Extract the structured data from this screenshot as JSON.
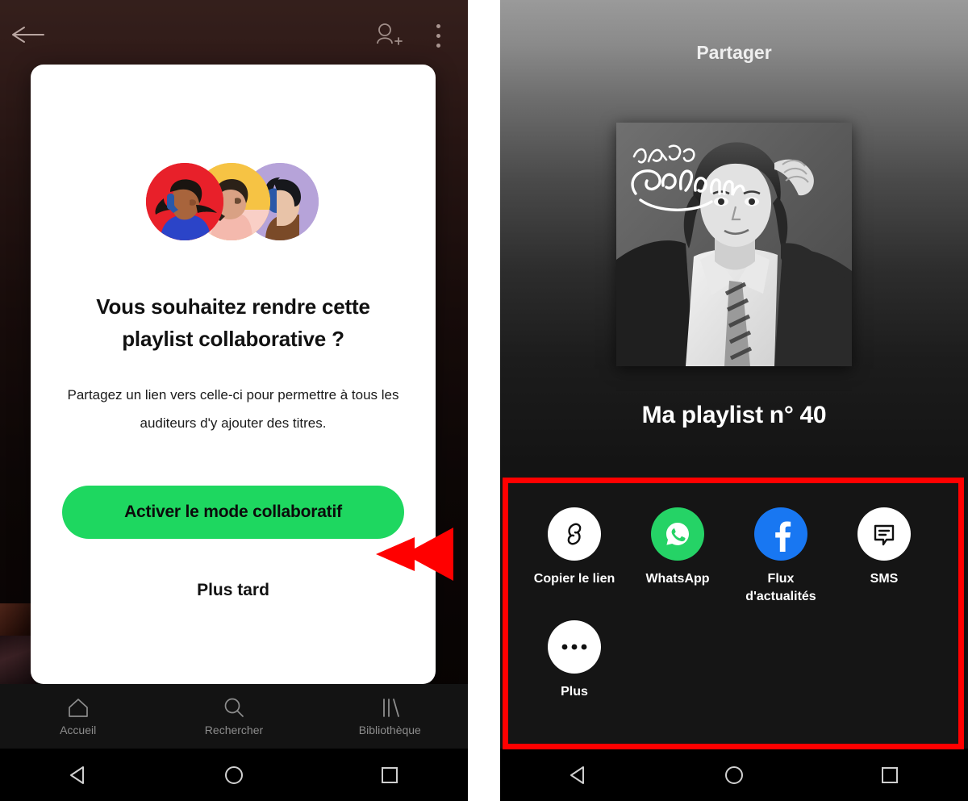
{
  "left_screen": {
    "topbar": {
      "back_icon": "arrow-left-icon",
      "add_person_icon": "person-add-icon",
      "overflow_icon": "kebab-menu-icon"
    },
    "modal": {
      "illustration": "three-listeners-avatars-illustration",
      "title": "Vous souhaitez rendre cette playlist collaborative ?",
      "body": "Partagez un lien vers celle-ci pour permettre à tous les auditeurs d'y ajouter des titres.",
      "primary_button": "Activer le mode collaboratif",
      "secondary_button": "Plus tard"
    },
    "annotation": {
      "arrow_color": "#ff0000",
      "points_to": "Activer le mode collaboratif"
    },
    "bottom_nav": [
      {
        "label": "Accueil",
        "icon": "home-icon"
      },
      {
        "label": "Rechercher",
        "icon": "search-icon"
      },
      {
        "label": "Bibliothèque",
        "icon": "library-icon"
      }
    ],
    "system_nav": [
      {
        "icon": "triangle-back-icon"
      },
      {
        "icon": "circle-home-icon"
      },
      {
        "icon": "square-recents-icon"
      }
    ]
  },
  "right_screen": {
    "header_title": "Partager",
    "album_art": {
      "artist_script": "Jean-Jacques",
      "artist_script_line2": "Goldman",
      "description": "black-and-white-portrait-album-cover"
    },
    "playlist_name": "Ma playlist n° 40",
    "annotation": {
      "box_color": "#ff0000",
      "highlights": "share-options-sheet"
    },
    "share_options": [
      {
        "label": "Copier le lien",
        "icon": "link-icon",
        "circle_color": "#ffffff"
      },
      {
        "label": "WhatsApp",
        "icon": "whatsapp-icon",
        "circle_color": "#25d366"
      },
      {
        "label": "Flux d'actualités",
        "icon": "facebook-icon",
        "circle_color": "#1877f2"
      },
      {
        "label": "SMS",
        "icon": "message-bubble-icon",
        "circle_color": "#ffffff"
      },
      {
        "label": "Plus",
        "icon": "ellipsis-icon",
        "circle_color": "#ffffff"
      }
    ],
    "system_nav": [
      {
        "icon": "triangle-back-icon"
      },
      {
        "icon": "circle-home-icon"
      },
      {
        "icon": "square-recents-icon"
      }
    ]
  },
  "colors": {
    "spotify_green": "#1ed760",
    "annotation_red": "#ff0000",
    "whatsapp_green": "#25d366",
    "facebook_blue": "#1877f2"
  }
}
